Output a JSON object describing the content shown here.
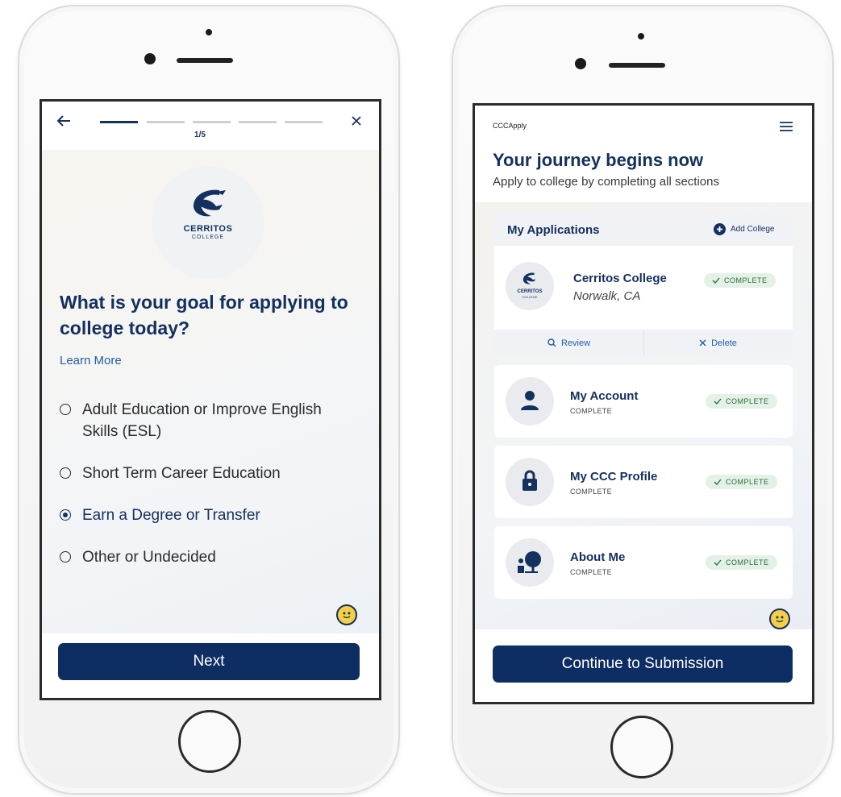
{
  "left_screen": {
    "progress": {
      "current": 1,
      "total": 5,
      "label": "1/5"
    },
    "logo": {
      "line1": "CERRITOS",
      "line2": "COLLEGE"
    },
    "question": "What is your goal for applying to college today?",
    "learn_more": "Learn More",
    "options": [
      {
        "label": "Adult Education or Improve English Skills (ESL)",
        "selected": false
      },
      {
        "label": "Short Term Career Education",
        "selected": false
      },
      {
        "label": "Earn a Degree or Transfer",
        "selected": true
      },
      {
        "label": "Other or Undecided",
        "selected": false
      }
    ],
    "next_label": "Next"
  },
  "right_screen": {
    "app_name": "CCCApply",
    "title": "Your journey begins now",
    "subtitle": "Apply to college by completing all sections",
    "applications": {
      "header": "My Applications",
      "add_label": "Add College",
      "college": {
        "name": "Cerritos College",
        "location": "Norwalk, CA",
        "status": "COMPLETE",
        "logo_line1": "CERRITOS",
        "logo_line2": "COLLEGE"
      },
      "review_label": "Review",
      "delete_label": "Delete"
    },
    "sections": [
      {
        "title": "My Account",
        "subtitle": "COMPLETE",
        "status": "COMPLETE",
        "icon": "person-icon"
      },
      {
        "title": "My CCC Profile",
        "subtitle": "COMPLETE",
        "status": "COMPLETE",
        "icon": "lock-icon"
      },
      {
        "title": "About Me",
        "subtitle": "COMPLETE",
        "status": "COMPLETE",
        "icon": "person-tree-icon"
      }
    ],
    "continue_label": "Continue to Submission"
  },
  "colors": {
    "navy": "#13305f",
    "button": "#0d2d63",
    "complete_bg": "#e4f1e7",
    "complete_text": "#2a6a3a",
    "link": "#1f5ea8"
  }
}
